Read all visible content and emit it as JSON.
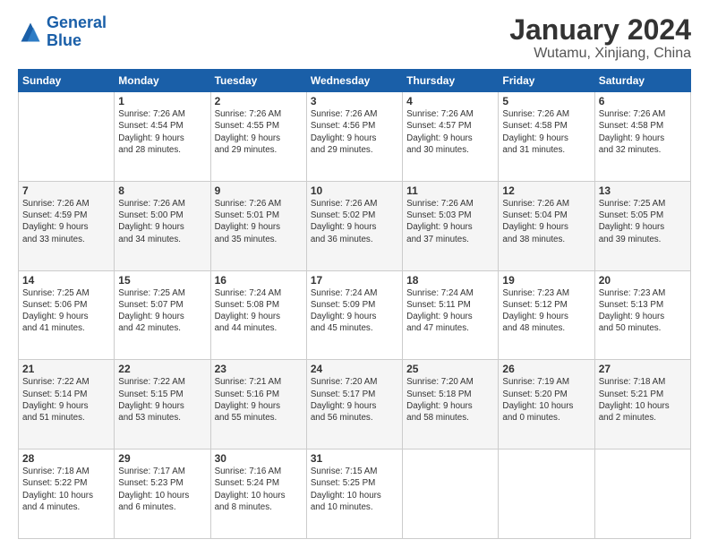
{
  "header": {
    "logo_line1": "General",
    "logo_line2": "Blue",
    "title": "January 2024",
    "subtitle": "Wutamu, Xinjiang, China"
  },
  "weekdays": [
    "Sunday",
    "Monday",
    "Tuesday",
    "Wednesday",
    "Thursday",
    "Friday",
    "Saturday"
  ],
  "weeks": [
    [
      {
        "day": "",
        "info": ""
      },
      {
        "day": "1",
        "info": "Sunrise: 7:26 AM\nSunset: 4:54 PM\nDaylight: 9 hours\nand 28 minutes."
      },
      {
        "day": "2",
        "info": "Sunrise: 7:26 AM\nSunset: 4:55 PM\nDaylight: 9 hours\nand 29 minutes."
      },
      {
        "day": "3",
        "info": "Sunrise: 7:26 AM\nSunset: 4:56 PM\nDaylight: 9 hours\nand 29 minutes."
      },
      {
        "day": "4",
        "info": "Sunrise: 7:26 AM\nSunset: 4:57 PM\nDaylight: 9 hours\nand 30 minutes."
      },
      {
        "day": "5",
        "info": "Sunrise: 7:26 AM\nSunset: 4:58 PM\nDaylight: 9 hours\nand 31 minutes."
      },
      {
        "day": "6",
        "info": "Sunrise: 7:26 AM\nSunset: 4:58 PM\nDaylight: 9 hours\nand 32 minutes."
      }
    ],
    [
      {
        "day": "7",
        "info": "Sunrise: 7:26 AM\nSunset: 4:59 PM\nDaylight: 9 hours\nand 33 minutes."
      },
      {
        "day": "8",
        "info": "Sunrise: 7:26 AM\nSunset: 5:00 PM\nDaylight: 9 hours\nand 34 minutes."
      },
      {
        "day": "9",
        "info": "Sunrise: 7:26 AM\nSunset: 5:01 PM\nDaylight: 9 hours\nand 35 minutes."
      },
      {
        "day": "10",
        "info": "Sunrise: 7:26 AM\nSunset: 5:02 PM\nDaylight: 9 hours\nand 36 minutes."
      },
      {
        "day": "11",
        "info": "Sunrise: 7:26 AM\nSunset: 5:03 PM\nDaylight: 9 hours\nand 37 minutes."
      },
      {
        "day": "12",
        "info": "Sunrise: 7:26 AM\nSunset: 5:04 PM\nDaylight: 9 hours\nand 38 minutes."
      },
      {
        "day": "13",
        "info": "Sunrise: 7:25 AM\nSunset: 5:05 PM\nDaylight: 9 hours\nand 39 minutes."
      }
    ],
    [
      {
        "day": "14",
        "info": "Sunrise: 7:25 AM\nSunset: 5:06 PM\nDaylight: 9 hours\nand 41 minutes."
      },
      {
        "day": "15",
        "info": "Sunrise: 7:25 AM\nSunset: 5:07 PM\nDaylight: 9 hours\nand 42 minutes."
      },
      {
        "day": "16",
        "info": "Sunrise: 7:24 AM\nSunset: 5:08 PM\nDaylight: 9 hours\nand 44 minutes."
      },
      {
        "day": "17",
        "info": "Sunrise: 7:24 AM\nSunset: 5:09 PM\nDaylight: 9 hours\nand 45 minutes."
      },
      {
        "day": "18",
        "info": "Sunrise: 7:24 AM\nSunset: 5:11 PM\nDaylight: 9 hours\nand 47 minutes."
      },
      {
        "day": "19",
        "info": "Sunrise: 7:23 AM\nSunset: 5:12 PM\nDaylight: 9 hours\nand 48 minutes."
      },
      {
        "day": "20",
        "info": "Sunrise: 7:23 AM\nSunset: 5:13 PM\nDaylight: 9 hours\nand 50 minutes."
      }
    ],
    [
      {
        "day": "21",
        "info": "Sunrise: 7:22 AM\nSunset: 5:14 PM\nDaylight: 9 hours\nand 51 minutes."
      },
      {
        "day": "22",
        "info": "Sunrise: 7:22 AM\nSunset: 5:15 PM\nDaylight: 9 hours\nand 53 minutes."
      },
      {
        "day": "23",
        "info": "Sunrise: 7:21 AM\nSunset: 5:16 PM\nDaylight: 9 hours\nand 55 minutes."
      },
      {
        "day": "24",
        "info": "Sunrise: 7:20 AM\nSunset: 5:17 PM\nDaylight: 9 hours\nand 56 minutes."
      },
      {
        "day": "25",
        "info": "Sunrise: 7:20 AM\nSunset: 5:18 PM\nDaylight: 9 hours\nand 58 minutes."
      },
      {
        "day": "26",
        "info": "Sunrise: 7:19 AM\nSunset: 5:20 PM\nDaylight: 10 hours\nand 0 minutes."
      },
      {
        "day": "27",
        "info": "Sunrise: 7:18 AM\nSunset: 5:21 PM\nDaylight: 10 hours\nand 2 minutes."
      }
    ],
    [
      {
        "day": "28",
        "info": "Sunrise: 7:18 AM\nSunset: 5:22 PM\nDaylight: 10 hours\nand 4 minutes."
      },
      {
        "day": "29",
        "info": "Sunrise: 7:17 AM\nSunset: 5:23 PM\nDaylight: 10 hours\nand 6 minutes."
      },
      {
        "day": "30",
        "info": "Sunrise: 7:16 AM\nSunset: 5:24 PM\nDaylight: 10 hours\nand 8 minutes."
      },
      {
        "day": "31",
        "info": "Sunrise: 7:15 AM\nSunset: 5:25 PM\nDaylight: 10 hours\nand 10 minutes."
      },
      {
        "day": "",
        "info": ""
      },
      {
        "day": "",
        "info": ""
      },
      {
        "day": "",
        "info": ""
      }
    ]
  ]
}
